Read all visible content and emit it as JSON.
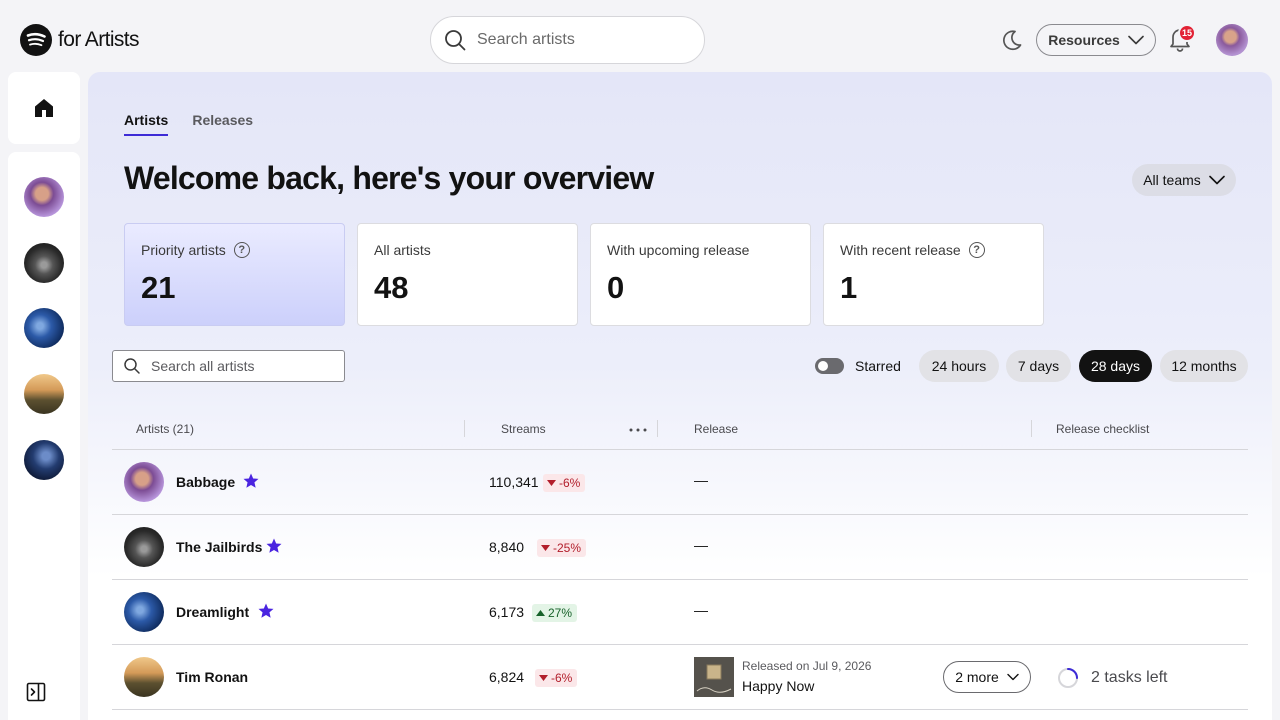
{
  "brand": {
    "name": "for Artists"
  },
  "header": {
    "search_placeholder": "Search artists",
    "resources_label": "Resources",
    "notification_count": "15"
  },
  "tabs": [
    {
      "label": "Artists",
      "active": true
    },
    {
      "label": "Releases",
      "active": false
    }
  ],
  "page_title": "Welcome back, here's your overview",
  "teams_label": "All teams",
  "summary_cards": [
    {
      "label": "Priority artists",
      "value": "21",
      "help": "?"
    },
    {
      "label": "All artists",
      "value": "48"
    },
    {
      "label": "With upcoming release",
      "value": "0"
    },
    {
      "label": "With recent release",
      "value": "1",
      "help": "?"
    }
  ],
  "filters": {
    "search_placeholder": "Search all artists",
    "starred_label": "Starred",
    "ranges": [
      {
        "label": "24 hours",
        "active": false
      },
      {
        "label": "7 days",
        "active": false
      },
      {
        "label": "28 days",
        "active": true
      },
      {
        "label": "12 months",
        "active": false
      }
    ]
  },
  "table": {
    "headers": {
      "artists": "Artists (21)",
      "streams": "Streams",
      "release": "Release",
      "checklist": "Release checklist"
    },
    "rows": [
      {
        "name": "Babbage",
        "streams": "110,341",
        "delta": "-6%",
        "trend": "down",
        "release": "—"
      },
      {
        "name": "The Jailbirds",
        "streams": "8,840",
        "delta": "-25%",
        "trend": "down",
        "release": "—"
      },
      {
        "name": "Dreamlight",
        "streams": "6,173",
        "delta": "27%",
        "trend": "up",
        "release": "—"
      },
      {
        "name": "Tim Ronan",
        "streams": "6,824",
        "delta": "-6%",
        "trend": "down",
        "release_date": "Released on Jul 9, 2026",
        "release_title": "Happy Now",
        "more_label": "2 more",
        "tasks_label": "2 tasks left"
      }
    ]
  },
  "colors": {
    "accent": "#3d2bd6",
    "star": "#4a24e0",
    "negative": "#b21e2b",
    "positive": "#17622a",
    "badge": "#e22134"
  }
}
